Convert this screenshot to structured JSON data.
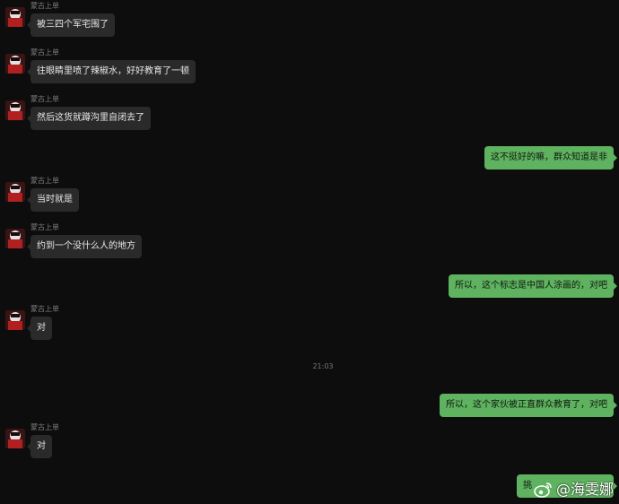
{
  "chat": {
    "sender_name": "蒙古上单",
    "timestamp": "21:03",
    "messages": [
      {
        "side": "left",
        "text": "被三四个军宅围了"
      },
      {
        "side": "left",
        "text": "往眼睛里喷了辣椒水，好好教育了一顿"
      },
      {
        "side": "left",
        "text": "然后这货就蹲沟里自闭去了"
      },
      {
        "side": "right",
        "text": "这不挺好的嘛，群众知道是非"
      },
      {
        "side": "left",
        "text": "当时就是"
      },
      {
        "side": "left",
        "text": "约到一个没什么人的地方"
      },
      {
        "side": "right",
        "text": "所以，这个标志是中国人涂画的，对吧"
      },
      {
        "side": "left",
        "text": "对"
      },
      {
        "side": "right",
        "text": "所以，这个家伙被正直群众教育了，对吧"
      },
      {
        "side": "left",
        "text": "对"
      },
      {
        "side": "right",
        "text": "挑"
      }
    ]
  },
  "watermark": {
    "text": "@海雯娜",
    "icon": "weibo-logo-icon"
  },
  "colors": {
    "background": "#0d0d0d",
    "left_bubble": "#2a2a2a",
    "right_bubble": "#5fb25f"
  }
}
